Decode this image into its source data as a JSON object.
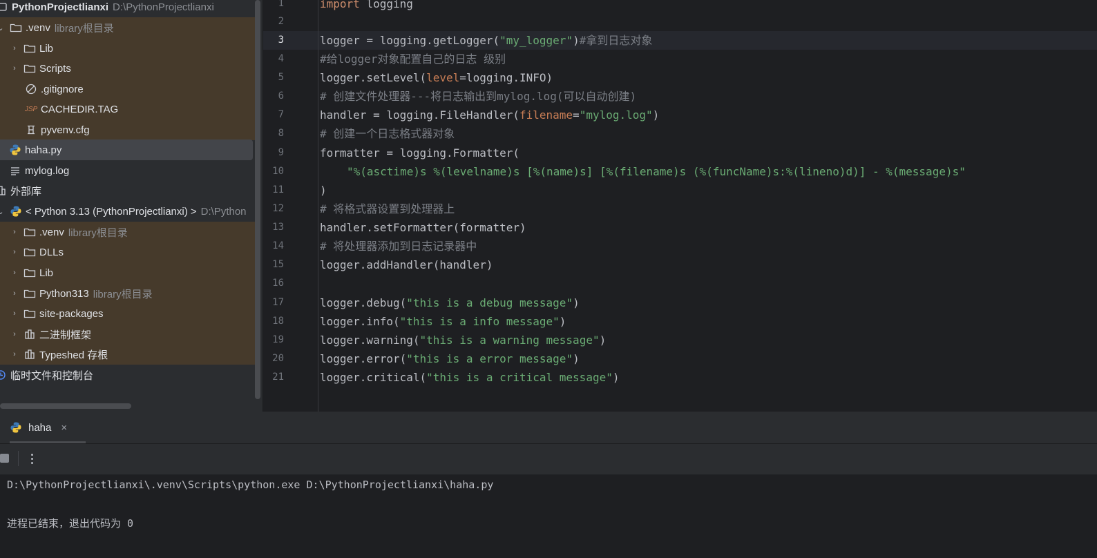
{
  "project_tree": {
    "root": {
      "name": "PythonProjectlianxi",
      "path": "D:\\PythonProjectlianxi"
    },
    "venv": {
      "name": ".venv",
      "hint": "library根目录"
    },
    "venv_children": [
      "Lib",
      "Scripts",
      ".gitignore",
      "CACHEDIR.TAG",
      "pyvenv.cfg"
    ],
    "files": [
      "haha.py",
      "mylog.log"
    ],
    "external_libs": "外部库",
    "interpreter": {
      "name": "< Python 3.13 (PythonProjectlianxi) >",
      "path": "D:\\Python"
    },
    "interp_children": [
      {
        "name": ".venv",
        "hint": "library根目录"
      },
      {
        "name": "DLLs",
        "hint": ""
      },
      {
        "name": "Lib",
        "hint": ""
      },
      {
        "name": "Python313",
        "hint": "library根目录"
      },
      {
        "name": "site-packages",
        "hint": ""
      },
      {
        "name": "二进制框架",
        "hint": ""
      },
      {
        "name": "Typeshed 存根",
        "hint": ""
      }
    ],
    "scratches": "临时文件和控制台"
  },
  "editor": {
    "line_numbers": [
      "1",
      "2",
      "3",
      "4",
      "5",
      "6",
      "7",
      "8",
      "9",
      "10",
      "11",
      "12",
      "13",
      "14",
      "15",
      "16",
      "17",
      "18",
      "19",
      "20",
      "21"
    ],
    "current_line": 3,
    "code": {
      "l1_kw": "import",
      "l1_rest": " logging",
      "l3_a": "logger = logging.getLogger(",
      "l3_str": "\"my_logger\"",
      "l3_b": ")",
      "l3_cmt": "#拿到日志对象",
      "l4_cmt": "#给logger对象配置自己的日志 级别",
      "l5_a": "logger.setLevel(",
      "l5_param": "level",
      "l5_b": "=logging.INFO)",
      "l6_cmt": "# 创建文件处理器---将日志输出到mylog.log(可以自动创建)",
      "l7_a": "handler = logging.FileHandler(",
      "l7_param": "filename",
      "l7_b": "=",
      "l7_str": "\"mylog.log\"",
      "l7_c": ")",
      "l8_cmt": "# 创建一个日志格式器对象",
      "l9": "formatter = logging.Formatter(",
      "l10_str": "\"%(asctime)s %(levelname)s [%(name)s] [%(filename)s (%(funcName)s:%(lineno)d)] - %(message)s\"",
      "l11": ")",
      "l12_cmt": "# 将格式器设置到处理器上",
      "l13": "handler.setFormatter(formatter)",
      "l14_cmt": "# 将处理器添加到日志记录器中",
      "l15": "logger.addHandler(handler)",
      "l17_a": "logger.debug(",
      "l17_str": "\"this is a debug message\"",
      "l18_a": "logger.info(",
      "l18_str": "\"this is a info message\"",
      "l19_a": "logger.warning(",
      "l19_str": "\"this is a warning message\"",
      "l20_a": "logger.error(",
      "l20_str": "\"this is a error message\"",
      "l21_a": "logger.critical(",
      "l21_str": "\"this is a critical message\"",
      "close_paren": ")"
    }
  },
  "run_panel": {
    "tab_label": "haha",
    "close_glyph": "×",
    "console": [
      "D:\\PythonProjectlianxi\\.venv\\Scripts\\python.exe D:\\PythonProjectlianxi\\haha.py",
      "进程已结束，退出代码为 0"
    ]
  },
  "colors": {
    "keyword": "#cf8e6d",
    "string": "#6aab73",
    "comment": "#7a7e85",
    "param": "#c77d55",
    "library_root_bg": "#463a2b"
  }
}
